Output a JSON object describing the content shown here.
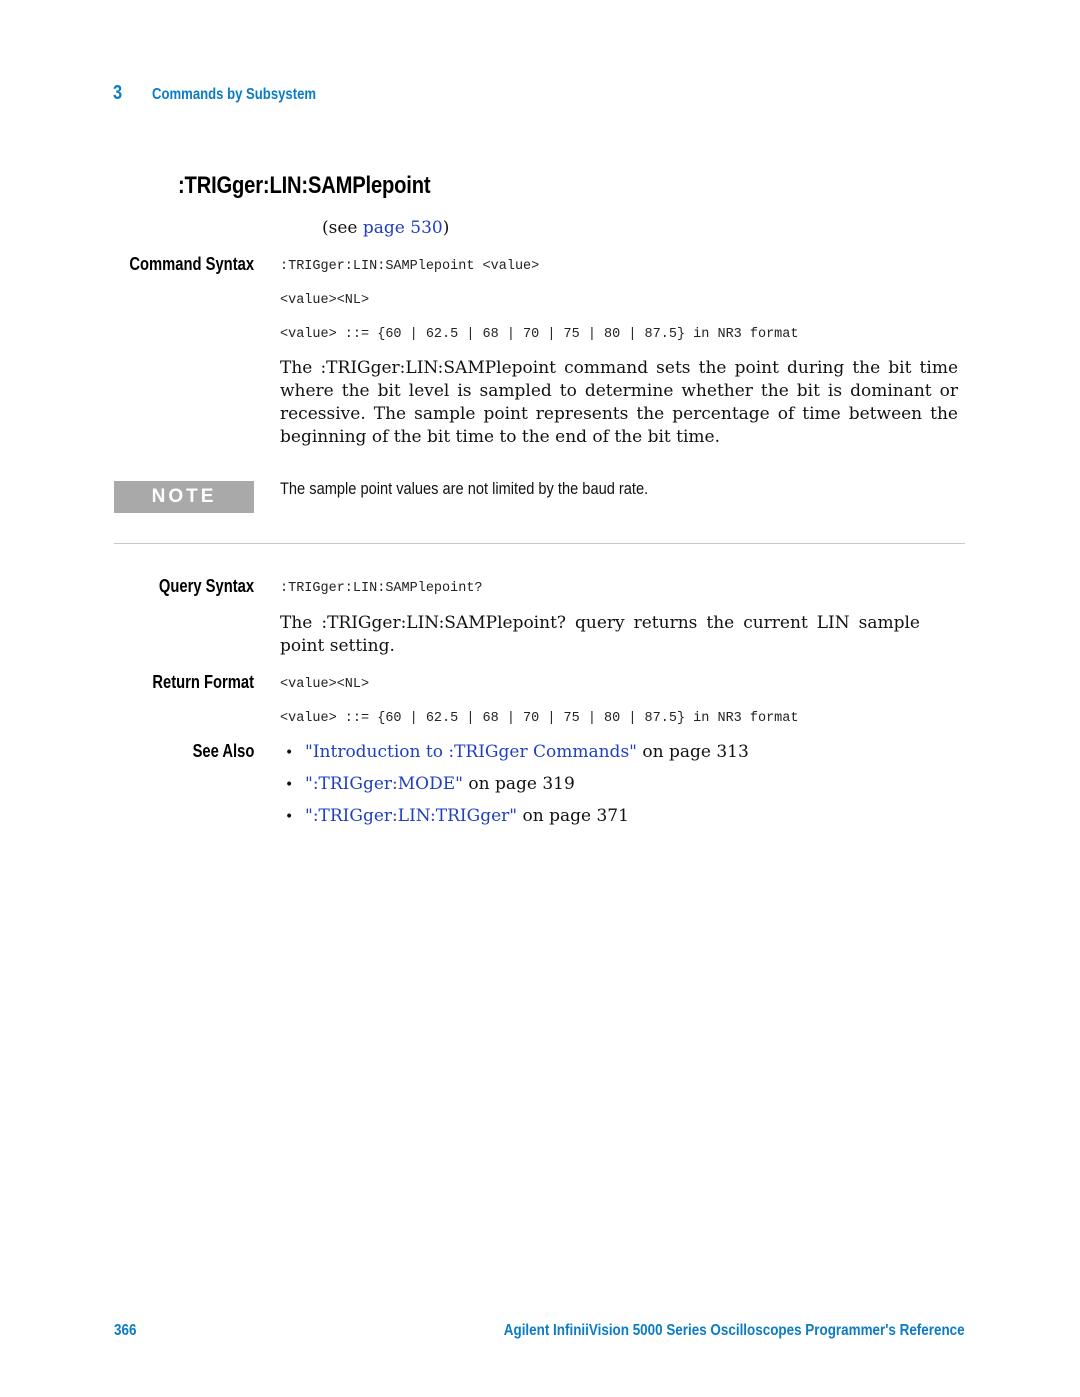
{
  "header": {
    "chapter_number": "3",
    "chapter_title": "Commands by Subsystem"
  },
  "title": ":TRIGger:LIN:SAMPlepoint",
  "see_page": {
    "prefix": "(see ",
    "link_text": "page 530",
    "suffix": ")"
  },
  "command_syntax": {
    "label": "Command Syntax",
    "lines": [
      ":TRIGger:LIN:SAMPlepoint <value>",
      "<value><NL>",
      "<value> ::= {60 | 62.5 | 68 | 70 | 75 | 80 | 87.5} in NR3 format"
    ],
    "description": "The :TRIGger:LIN:SAMPlepoint command sets the point during the bit time where the bit level is sampled to determine whether the bit is dominant or recessive. The sample point represents the percentage of time between the beginning of the bit time to the end of the bit time."
  },
  "note": {
    "label": "NOTE",
    "text": "The sample point values are not limited by the baud rate."
  },
  "query_syntax": {
    "label": "Query Syntax",
    "line": ":TRIGger:LIN:SAMPlepoint?",
    "description": "The :TRIGger:LIN:SAMPlepoint? query returns the current LIN sample point setting."
  },
  "return_format": {
    "label": "Return Format",
    "lines": [
      "<value><NL>",
      "<value> ::= {60 | 62.5 | 68 | 70 | 75 | 80 | 87.5} in NR3 format"
    ]
  },
  "see_also": {
    "label": "See Also",
    "bullet": "•",
    "items": [
      {
        "link": "\"Introduction to :TRIGger Commands\"",
        "suffix": " on page 313"
      },
      {
        "link": "\":TRIGger:MODE\"",
        "suffix": " on page 319"
      },
      {
        "link": "\":TRIGger:LIN:TRIGger\"",
        "suffix": " on page 371"
      }
    ]
  },
  "footer": {
    "page_number": "366",
    "book_title": "Agilent InfiniiVision 5000 Series Oscilloscopes Programmer's Reference"
  },
  "colors": {
    "accent": "#0a7cc6",
    "link": "#1f3fbf",
    "note_box": "#a9a9a9",
    "divider": "#c8c8c8"
  }
}
